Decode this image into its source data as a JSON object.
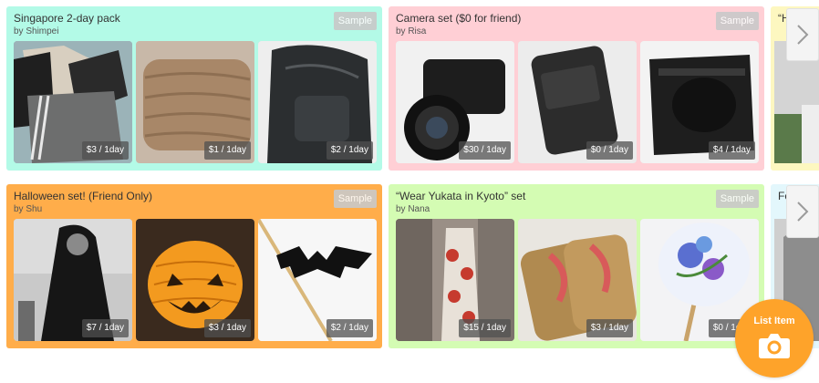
{
  "cards": [
    {
      "title": "Singapore 2-day pack",
      "author": "by Shimpei",
      "badge": "Sample",
      "bg": "#b3fae7",
      "items": [
        {
          "price": "$3 / 1day",
          "icon": "clothes-photo"
        },
        {
          "price": "$1 / 1day",
          "icon": "towel-photo"
        },
        {
          "price": "$2 / 1day",
          "icon": "backpack-photo"
        }
      ]
    },
    {
      "title": "Camera set ($0 for friend)",
      "author": "by Risa",
      "badge": "Sample",
      "bg": "#ffcfd5",
      "items": [
        {
          "price": "$30 / 1day",
          "icon": "camera-photo"
        },
        {
          "price": "$0 / 1day",
          "icon": "charger-photo"
        },
        {
          "price": "$4 / 1day",
          "icon": "camera-bag-photo"
        }
      ]
    },
    {
      "title": "Halloween set! (Friend Only)",
      "author": "by Shu",
      "badge": "Sample",
      "bg": "#ffad4a",
      "items": [
        {
          "price": "$7 / 1day",
          "icon": "costume-photo"
        },
        {
          "price": "$3 / 1day",
          "icon": "pumpkin-lantern-photo"
        },
        {
          "price": "$2 / 1day",
          "icon": "bat-decoration-photo"
        }
      ]
    },
    {
      "title": "“Wear Yukata in Kyoto” set",
      "author": "by Nana",
      "badge": "Sample",
      "bg": "#d4fcb3",
      "items": [
        {
          "price": "$15 / 1day",
          "icon": "yukata-photo"
        },
        {
          "price": "$3 / 1day",
          "icon": "geta-sandals-photo"
        },
        {
          "price": "$0 / 1day",
          "icon": "paper-fan-photo"
        }
      ]
    }
  ],
  "peeks": [
    {
      "title": "“H",
      "bg": "#fdf7c0"
    },
    {
      "title": "Fo",
      "bg": "#e3f7fc"
    }
  ],
  "list_button": {
    "label": "List Item"
  },
  "colors": {
    "badge": "#c9c9c9",
    "list_button": "#fea32a"
  }
}
